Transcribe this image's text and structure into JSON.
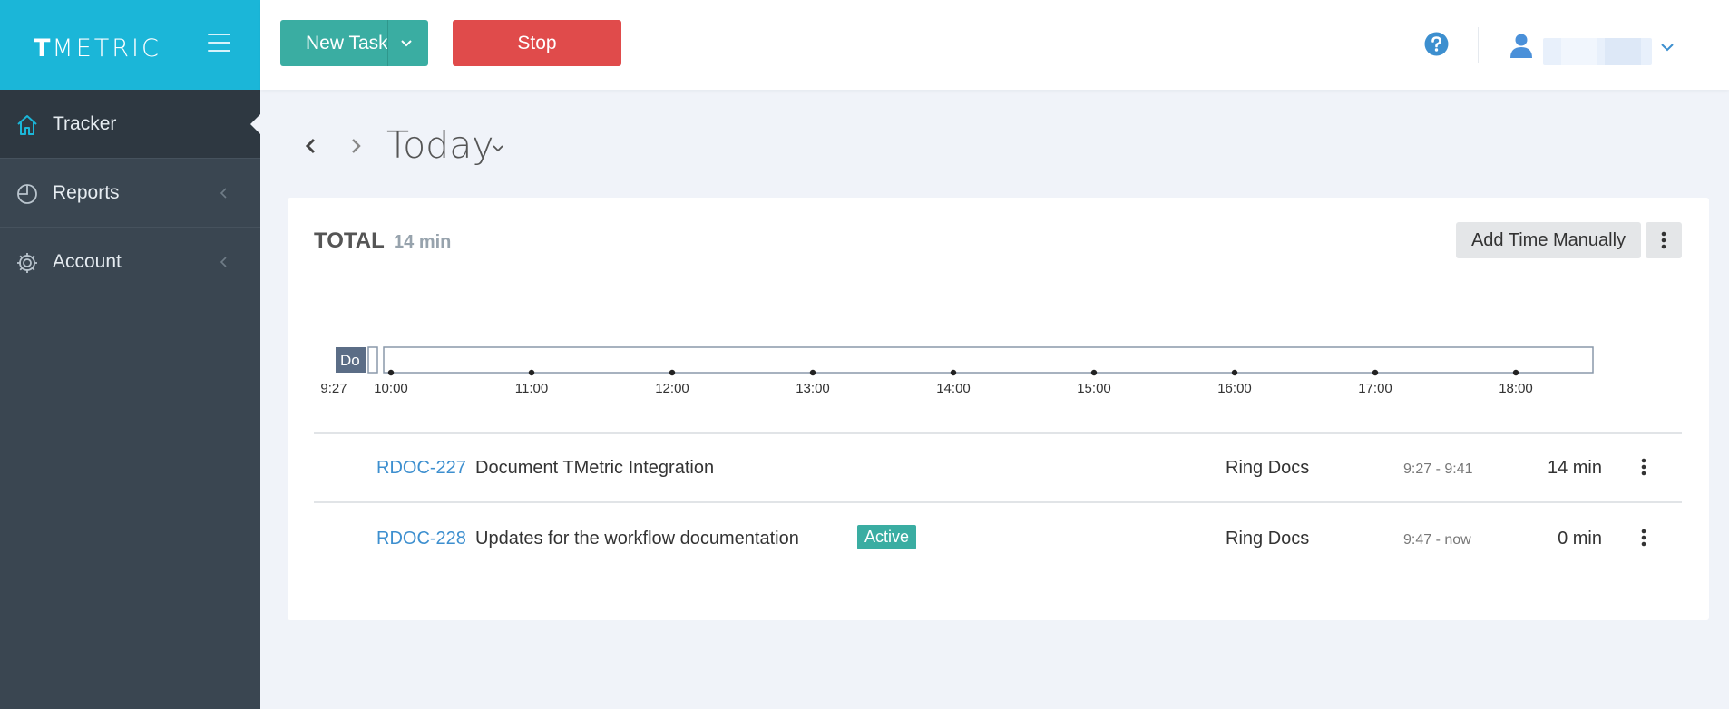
{
  "brand": {
    "logo_bold": "T",
    "logo_rest": "METRIC"
  },
  "sidebar": {
    "items": [
      {
        "label": "Tracker",
        "icon": "home-icon",
        "active": true
      },
      {
        "label": "Reports",
        "icon": "pie-chart-icon",
        "active": false
      },
      {
        "label": "Account",
        "icon": "gear-icon",
        "active": false
      }
    ]
  },
  "topbar": {
    "new_task_label": "New Task",
    "stop_label": "Stop",
    "help_icon": "question-circle-icon",
    "user_icon": "user-icon"
  },
  "date_nav": {
    "title": "Today"
  },
  "summary": {
    "total_label": "TOTAL",
    "total_duration": "14 min",
    "add_time_label": "Add Time Manually"
  },
  "timeline": {
    "start_label": "9:27",
    "hours": [
      "10:00",
      "11:00",
      "12:00",
      "13:00",
      "14:00",
      "15:00",
      "16:00",
      "17:00",
      "18:00"
    ],
    "entry_label": "Do",
    "colors": {
      "entry": "#5b6d86",
      "frame": "#8a99aa"
    }
  },
  "entries": [
    {
      "id": "RDOC-227",
      "name": "Document TMetric Integration",
      "badge": "",
      "project": "Ring Docs",
      "range": "9:27 - 9:41",
      "duration": "14 min"
    },
    {
      "id": "RDOC-228",
      "name": "Updates for the workflow documentation",
      "badge": "Active",
      "project": "Ring Docs",
      "range": "9:47 - now",
      "duration": "0 min"
    }
  ],
  "colors": {
    "brand": "#1bb6d8",
    "primary": "#3aada2",
    "danger": "#e04b4b",
    "link": "#3d8fcf",
    "sidebar": "#3a4651"
  }
}
